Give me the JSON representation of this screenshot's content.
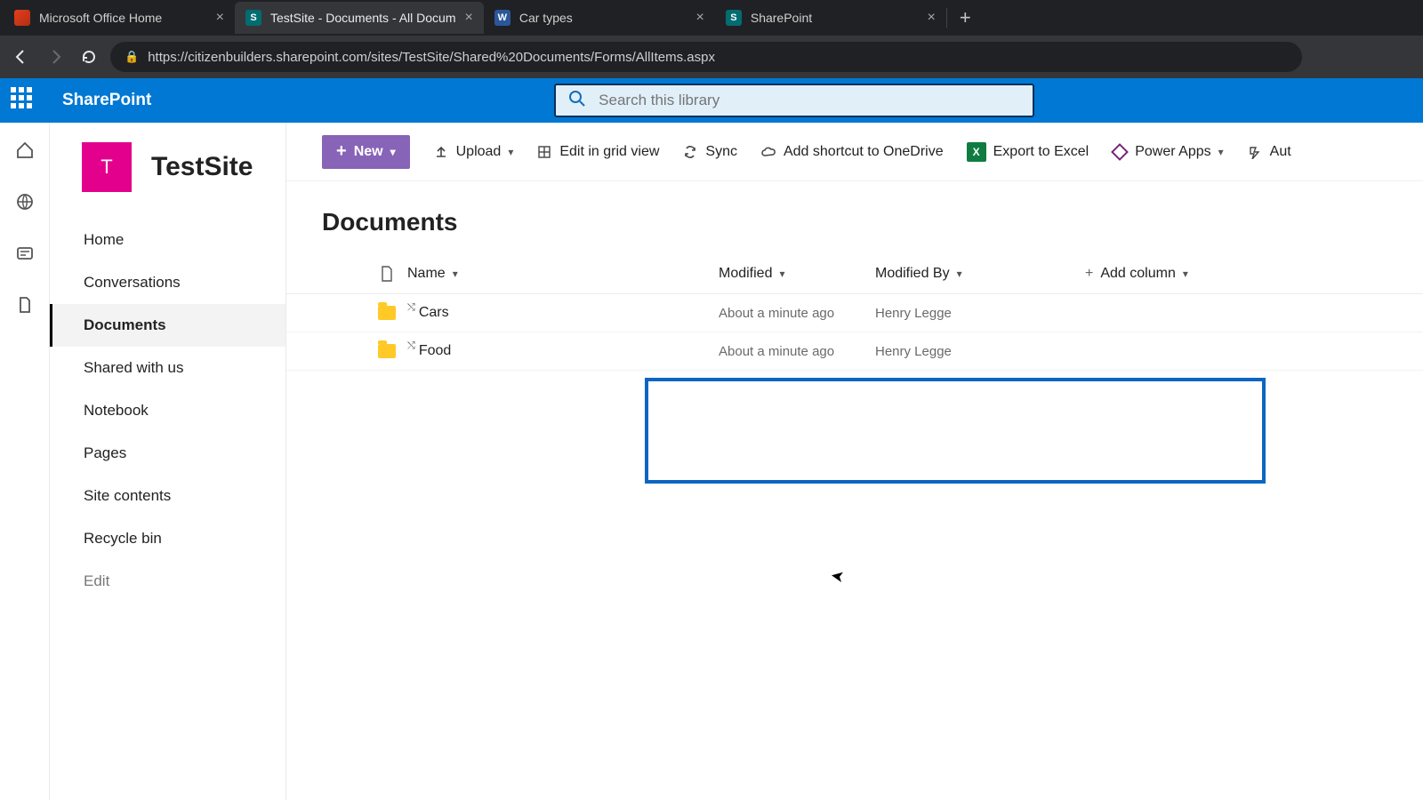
{
  "browser": {
    "tabs": [
      {
        "title": "Microsoft Office Home",
        "favicon_color": "linear-gradient(135deg,#e43e1b,#b12f14)"
      },
      {
        "title": "TestSite - Documents - All Docum",
        "favicon_color": "#036c70",
        "favicon_letter": "S"
      },
      {
        "title": "Car types",
        "favicon_color": "#2b579a",
        "favicon_letter": "W"
      },
      {
        "title": "SharePoint",
        "favicon_color": "#036c70",
        "favicon_letter": "S"
      }
    ],
    "active_tab_index": 1,
    "url": "https://citizenbuilders.sharepoint.com/sites/TestSite/Shared%20Documents/Forms/AllItems.aspx"
  },
  "header": {
    "brand": "SharePoint",
    "search_placeholder": "Search this library"
  },
  "site": {
    "logo_letter": "T",
    "name": "TestSite"
  },
  "sidebar": {
    "items": [
      "Home",
      "Conversations",
      "Documents",
      "Shared with us",
      "Notebook",
      "Pages",
      "Site contents",
      "Recycle bin"
    ],
    "edit_label": "Edit",
    "active_index": 2
  },
  "toolbar": {
    "new_label": "New",
    "upload_label": "Upload",
    "edit_grid_label": "Edit in grid view",
    "sync_label": "Sync",
    "shortcut_label": "Add shortcut to OneDrive",
    "export_label": "Export to Excel",
    "powerapps_label": "Power Apps",
    "automate_label": "Aut"
  },
  "list": {
    "title": "Documents",
    "columns": {
      "name": "Name",
      "modified": "Modified",
      "modified_by": "Modified By",
      "add": "Add column"
    },
    "rows": [
      {
        "name": "Cars",
        "modified": "About a minute ago",
        "modified_by": "Henry Legge"
      },
      {
        "name": "Food",
        "modified": "About a minute ago",
        "modified_by": "Henry Legge"
      }
    ]
  }
}
